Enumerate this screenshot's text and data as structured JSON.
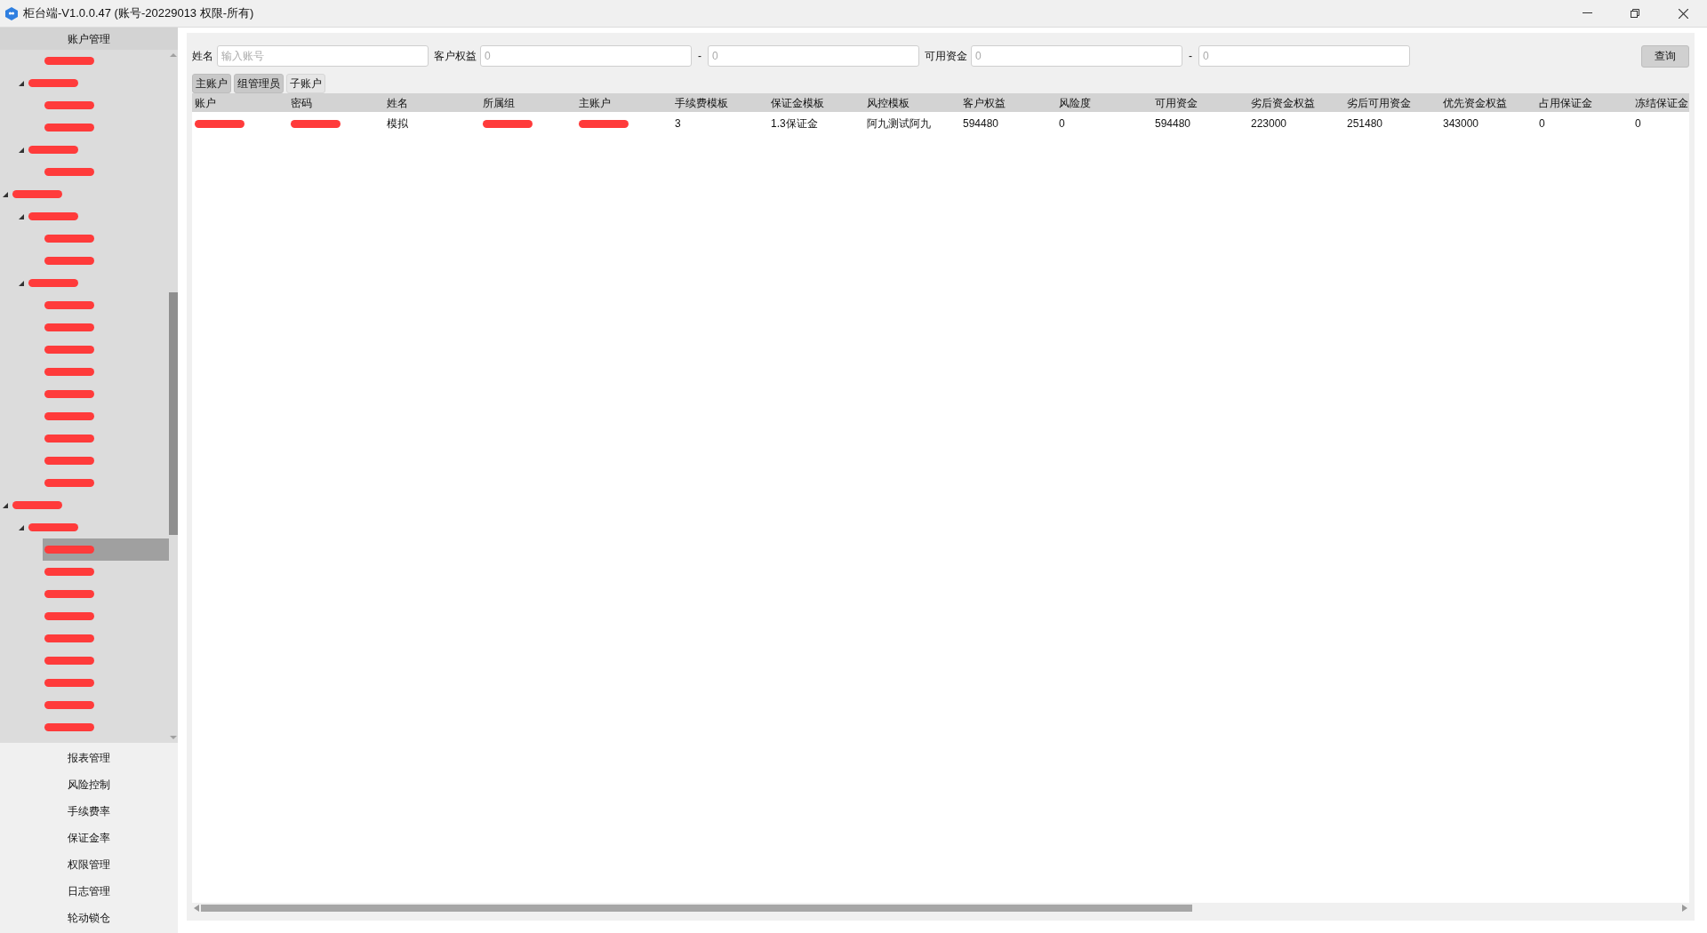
{
  "window": {
    "title": "柜台端-V1.0.0.47 (账号-20229013 权限-所有)"
  },
  "sidebar": {
    "header": "账户管理",
    "tree_continued": {
      "leaves": [
        {
          "selected": false
        }
      ],
      "groups": [
        {
          "expanded": true,
          "selected": false,
          "children": [
            {
              "selected": false
            },
            {
              "selected": false
            }
          ]
        },
        {
          "expanded": true,
          "selected": false,
          "children": [
            {
              "selected": false
            }
          ]
        }
      ]
    },
    "tree": [
      {
        "expanded": true,
        "selected": false,
        "children": [
          {
            "expanded": true,
            "selected": false,
            "children": [
              {
                "selected": false
              },
              {
                "selected": false
              }
            ]
          },
          {
            "expanded": true,
            "selected": false,
            "children": [
              {
                "selected": false
              },
              {
                "selected": false
              },
              {
                "selected": false
              },
              {
                "selected": false
              },
              {
                "selected": false
              },
              {
                "selected": false
              },
              {
                "selected": false
              },
              {
                "selected": false
              },
              {
                "selected": false
              }
            ]
          }
        ]
      },
      {
        "expanded": true,
        "selected": false,
        "children": [
          {
            "expanded": true,
            "selected": false,
            "children": [
              {
                "selected": true
              },
              {
                "selected": false
              },
              {
                "selected": false
              },
              {
                "selected": false
              },
              {
                "selected": false
              },
              {
                "selected": false
              },
              {
                "selected": false
              },
              {
                "selected": false
              },
              {
                "selected": false
              }
            ]
          }
        ]
      }
    ],
    "menu": [
      "报表管理",
      "风险控制",
      "手续费率",
      "保证金率",
      "权限管理",
      "日志管理",
      "轮动锁仓"
    ]
  },
  "filters": {
    "name_label": "姓名",
    "name_placeholder": "输入账号",
    "equity_label": "客户权益",
    "equity_from": "0",
    "equity_to": "0",
    "funds_label": "可用资金",
    "funds_from": "0",
    "funds_to": "0",
    "range_separators": [
      "-",
      "-"
    ],
    "query_button": "查询"
  },
  "tabs": [
    {
      "label": "主账户",
      "selected": true
    },
    {
      "label": "组管理员",
      "selected": true
    },
    {
      "label": "子账户",
      "selected": false
    }
  ],
  "table": {
    "columns": [
      "账户",
      "密码",
      "姓名",
      "所属组",
      "主账户",
      "手续费模板",
      "保证金模板",
      "风控模板",
      "客户权益",
      "风险度",
      "可用资金",
      "劣后资金权益",
      "劣后可用资金",
      "优先资金权益",
      "占用保证金",
      "冻结保证金"
    ],
    "rows": [
      [
        {
          "redacted": true
        },
        {
          "redacted": true
        },
        {
          "text": "模拟"
        },
        {
          "redacted": true
        },
        {
          "redacted": true
        },
        {
          "text": "3"
        },
        {
          "text": "1.3保证金"
        },
        {
          "text": "阿九测试阿九"
        },
        {
          "text": "594480"
        },
        {
          "text": "0"
        },
        {
          "text": "594480"
        },
        {
          "text": "223000"
        },
        {
          "text": "251480"
        },
        {
          "text": "343000"
        },
        {
          "text": "0"
        },
        {
          "text": "0"
        }
      ]
    ]
  }
}
